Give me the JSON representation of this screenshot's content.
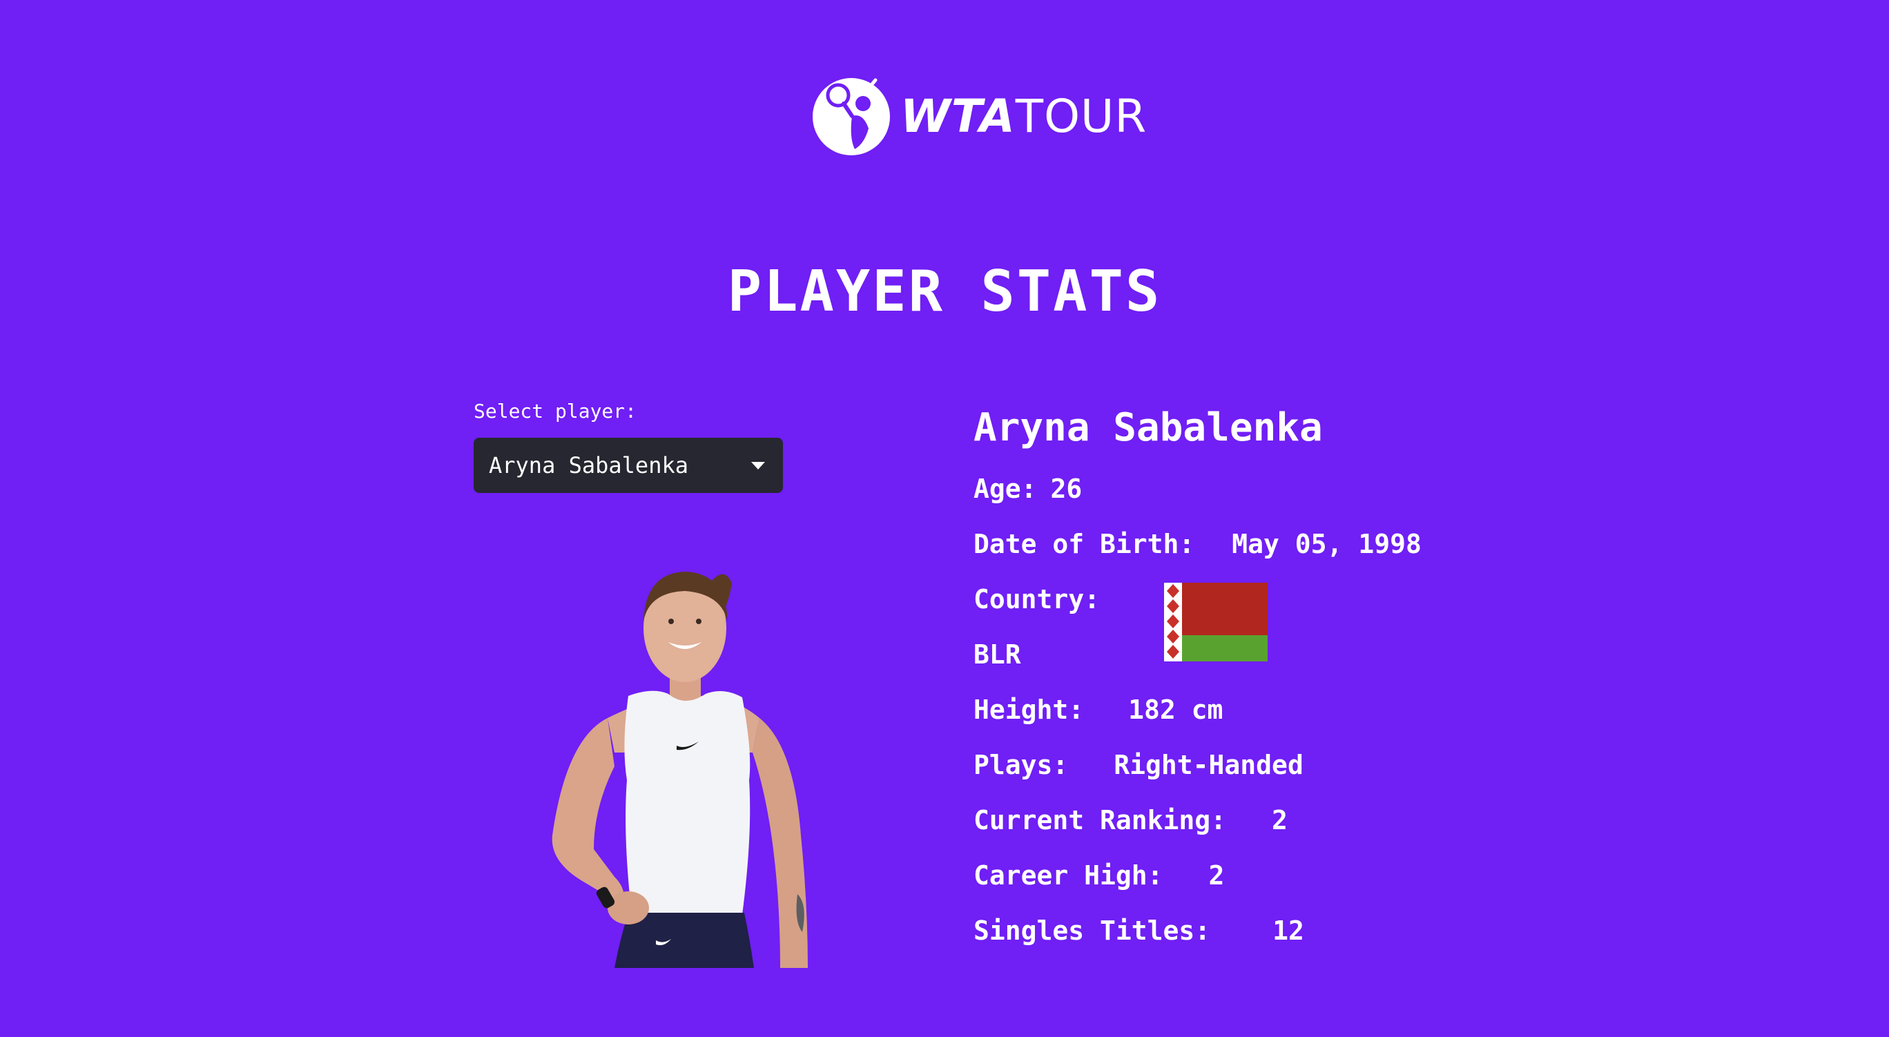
{
  "logo": {
    "brand": "WTA",
    "sub": "TOUR",
    "icon": "wta-player-logo-icon"
  },
  "page_title": "PLAYER STATS",
  "select": {
    "label": "Select player:",
    "value": "Aryna Sabalenka",
    "chevron_icon": "chevron-down-icon"
  },
  "player": {
    "name": "Aryna Sabalenka",
    "age_label": "Age:",
    "age": "26",
    "dob_label": "Date of Birth:",
    "dob": "May 05, 1998",
    "country_label": "Country:",
    "country_code": "BLR",
    "height_label": "Height:",
    "height": "182 cm",
    "plays_label": "Plays:",
    "plays": "Right-Handed",
    "ranking_label": "Current Ranking:",
    "ranking": "2",
    "career_high_label": "Career High:",
    "career_high": "2",
    "titles_label": "Singles Titles:",
    "titles": "12"
  },
  "colors": {
    "background": "#701ff4",
    "select_bg": "#262730",
    "text": "#ffffff",
    "flag_red": "#b1261e",
    "flag_green": "#5aa22f"
  }
}
